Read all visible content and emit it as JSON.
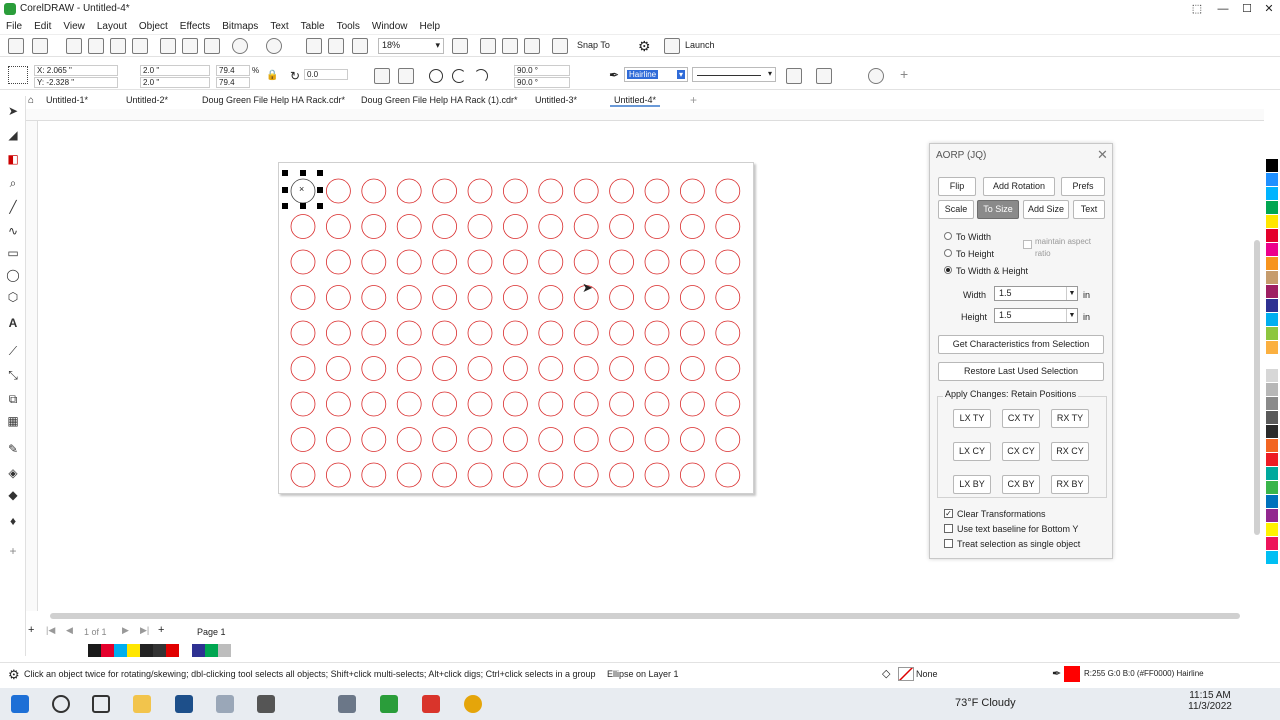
{
  "app": {
    "title": "CorelDRAW - Untitled-4*"
  },
  "colors": {
    "accent": "#2f6bd8",
    "circle_stroke": "#d92a2a",
    "outline_red": "#ff0000"
  },
  "menu": [
    "File",
    "Edit",
    "View",
    "Layout",
    "Object",
    "Effects",
    "Bitmaps",
    "Text",
    "Table",
    "Tools",
    "Window",
    "Help"
  ],
  "toolbar": {
    "zoom": "18%",
    "snap_to": "Snap To",
    "launch": "Launch"
  },
  "properties": {
    "x": "X: 2.065 \"",
    "y": "Y: -2.328 \"",
    "w": "2.0 \"",
    "h": "2.0 \"",
    "sx": "79.4",
    "sy": "79.4",
    "pct": "%",
    "rot": "0.0",
    "start_angle": "90.0 °",
    "end_angle": "90.0 °",
    "outline_width": "Hairline"
  },
  "tabs": [
    "Untitled-1*",
    "Untitled-2*",
    "Doug Green File Help HA Rack.cdr*",
    "Doug Green File Help HA Rack (1).cdr*",
    "Untitled-3*",
    "Untitled-4*"
  ],
  "active_tab": 5,
  "canvas": {
    "rows": 9,
    "cols": 13
  },
  "pagenav": {
    "count": "1 of 1",
    "page": "Page 1"
  },
  "dialog": {
    "title": "AORP (JQ)",
    "row1": [
      "Flip",
      "Add Rotation",
      "Prefs"
    ],
    "row2": [
      "Scale",
      "To Size",
      "Add Size",
      "Text"
    ],
    "radios": [
      "To Width",
      "To Height",
      "To Width & Height"
    ],
    "maintain": "maintain aspect ratio",
    "width_label": "Width",
    "width_value": "1.5",
    "height_label": "Height",
    "height_value": "1.5",
    "unit": "in",
    "get_chars": "Get Characteristics from Selection",
    "restore": "Restore Last Used Selection",
    "apply_label": "Apply Changes: Retain Positions",
    "grid": [
      [
        "LX TY",
        "CX TY",
        "RX TY"
      ],
      [
        "LX CY",
        "CX CY",
        "RX CY"
      ],
      [
        "LX BY",
        "CX BY",
        "RX BY"
      ]
    ],
    "checks": [
      "Clear Transformations",
      "Use text baseline for Bottom Y",
      "Treat selection as single object"
    ]
  },
  "status": {
    "hint": "Click an object twice for rotating/skewing; dbl-clicking tool selects all objects; Shift+click multi-selects; Alt+click digs; Ctrl+click selects in a group",
    "object": "Ellipse on Layer 1",
    "fill": "None",
    "outline": "R:255 G:0 B:0 (#FF0000)  Hairline"
  },
  "taskbar": {
    "weather": "73°F  Cloudy",
    "time": "11:15 AM",
    "date": "11/3/2022"
  },
  "palette": [
    "#ffffff",
    "#000000",
    "#1e90ff",
    "#00b4ff",
    "#00a651",
    "#ffe600",
    "#e4002b",
    "#ec008c",
    "#f7941d",
    "#c69c6d",
    "#9e1f63",
    "#2e3192",
    "#00aeef",
    "#8dc63f",
    "#fbb040",
    "#ffffff",
    "#d7d7d7",
    "#b7b7b7",
    "#8a8a8a",
    "#5a5a5a",
    "#2a2a2a",
    "#f26522",
    "#ed1c24",
    "#00a99d",
    "#39b54a",
    "#0072bc",
    "#92278f",
    "#fff200",
    "#ed145b",
    "#00bff3"
  ],
  "docpalette": [
    "#1a1a1a",
    "#e4002b",
    "#00aeef",
    "#ffe600",
    "#222222",
    "#333333",
    "#e10000",
    "#ffffff",
    "#2e3192",
    "#00a651",
    "#bdbdbd"
  ]
}
